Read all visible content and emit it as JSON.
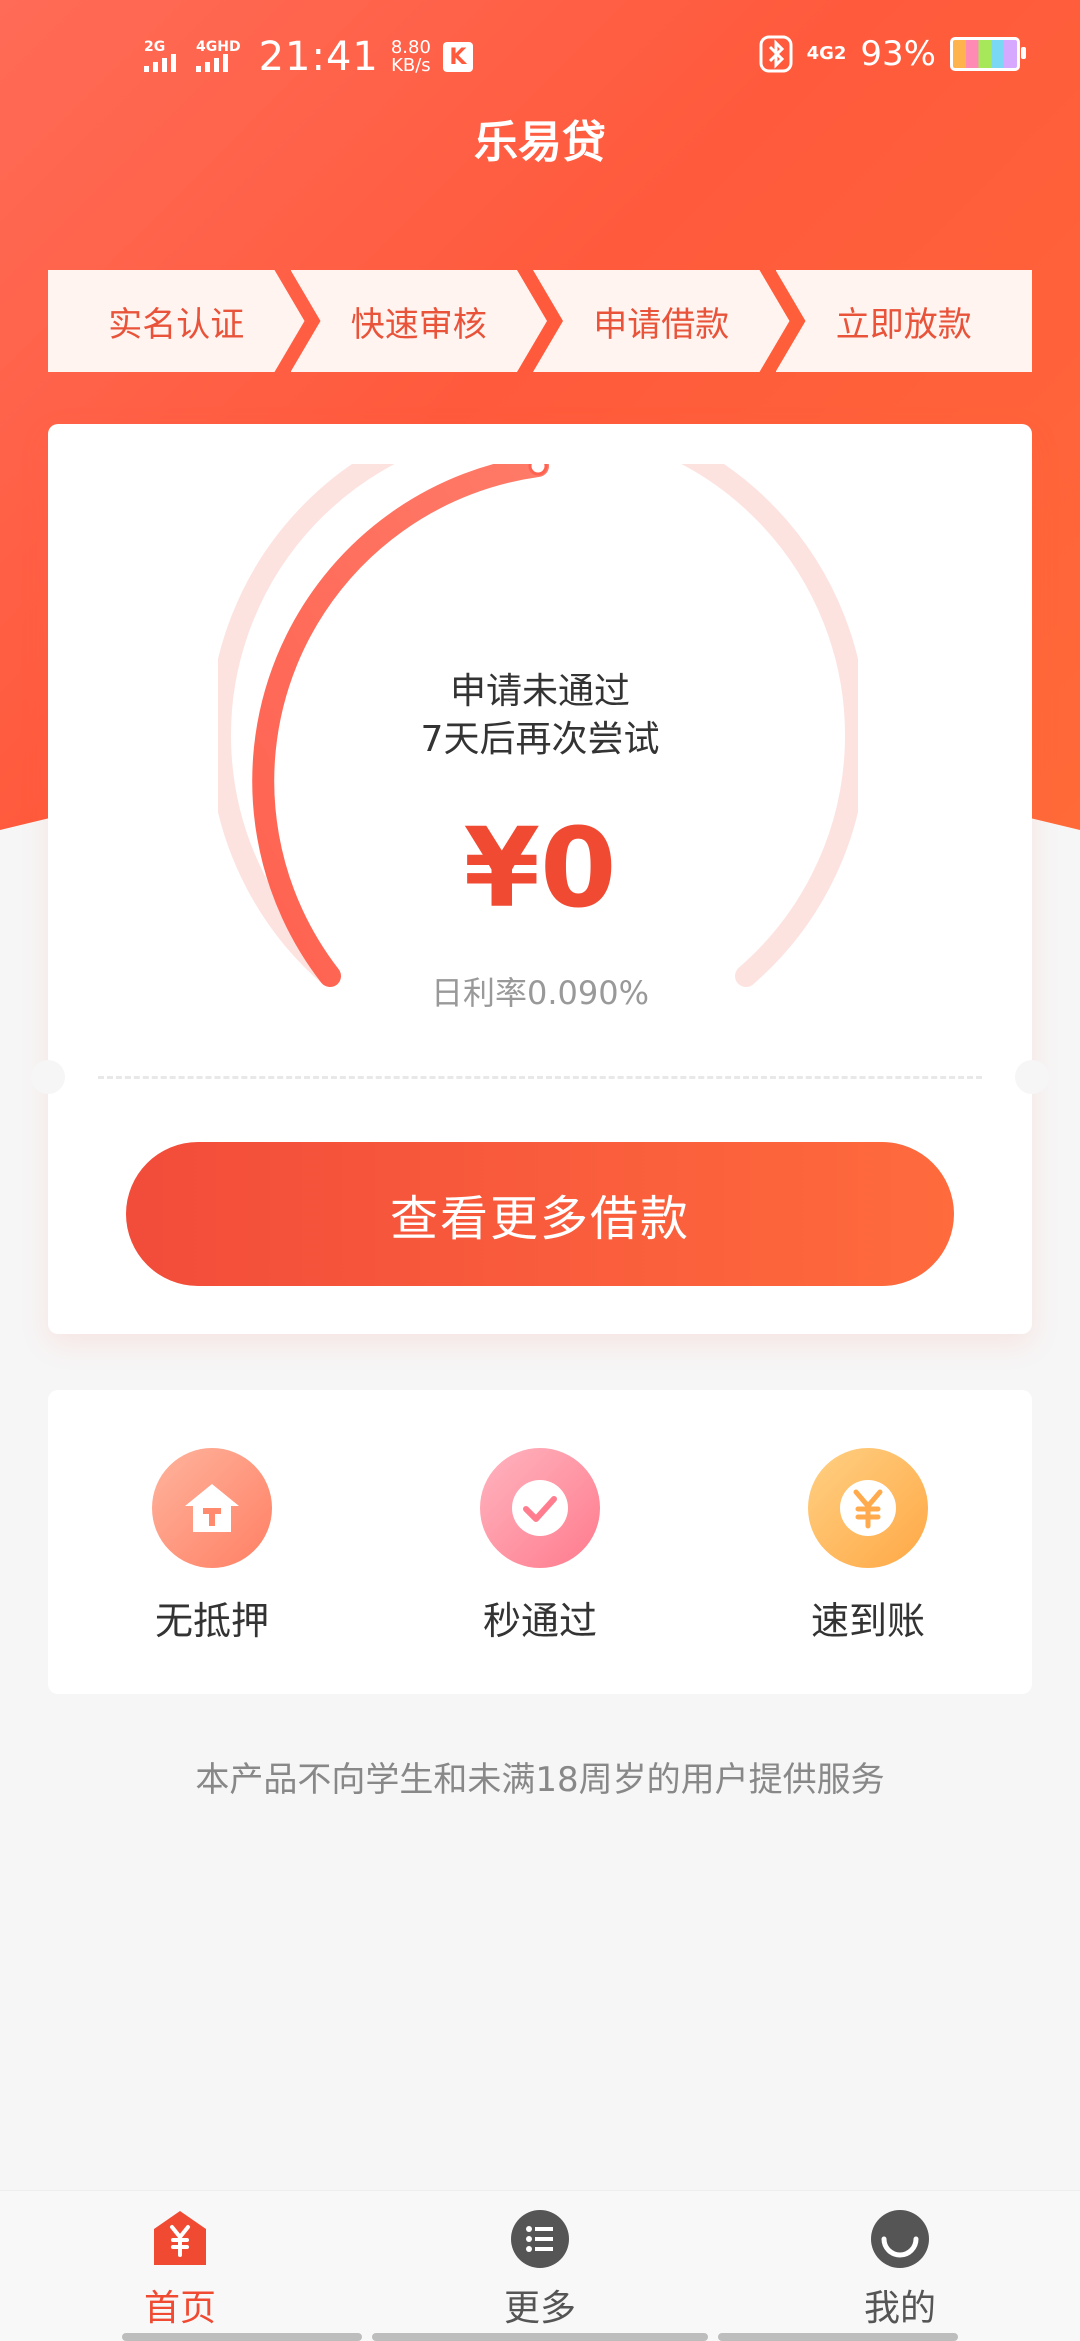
{
  "status_bar": {
    "net1": "2G",
    "net2": "4GHD",
    "time": "21:41",
    "speed_value": "8.80",
    "speed_unit": "KB/s",
    "k_icon": "K",
    "right_net": "4G2",
    "battery_pct": "93%"
  },
  "app": {
    "title": "乐易贷"
  },
  "steps": [
    "实名认证",
    "快速审核",
    "申请借款",
    "立即放款"
  ],
  "card": {
    "status_line1": "申请未通过",
    "status_line2": "7天后再次尝试",
    "amount": "¥0",
    "rate": "日利率0.090%",
    "cta_label": "查看更多借款",
    "gauge_progress": 0.5
  },
  "features": [
    {
      "label": "无抵押",
      "icon": "house-icon"
    },
    {
      "label": "秒通过",
      "icon": "check-icon"
    },
    {
      "label": "速到账",
      "icon": "yen-icon"
    }
  ],
  "disclaimer": "本产品不向学生和未满18周岁的用户提供服务",
  "tabbar": [
    {
      "label": "首页",
      "icon": "home-yen-icon",
      "active": true
    },
    {
      "label": "更多",
      "icon": "list-icon",
      "active": false
    },
    {
      "label": "我的",
      "icon": "profile-icon",
      "active": false
    }
  ],
  "colors": {
    "accent": "#f04a33",
    "hero": "#ff5a3c"
  }
}
